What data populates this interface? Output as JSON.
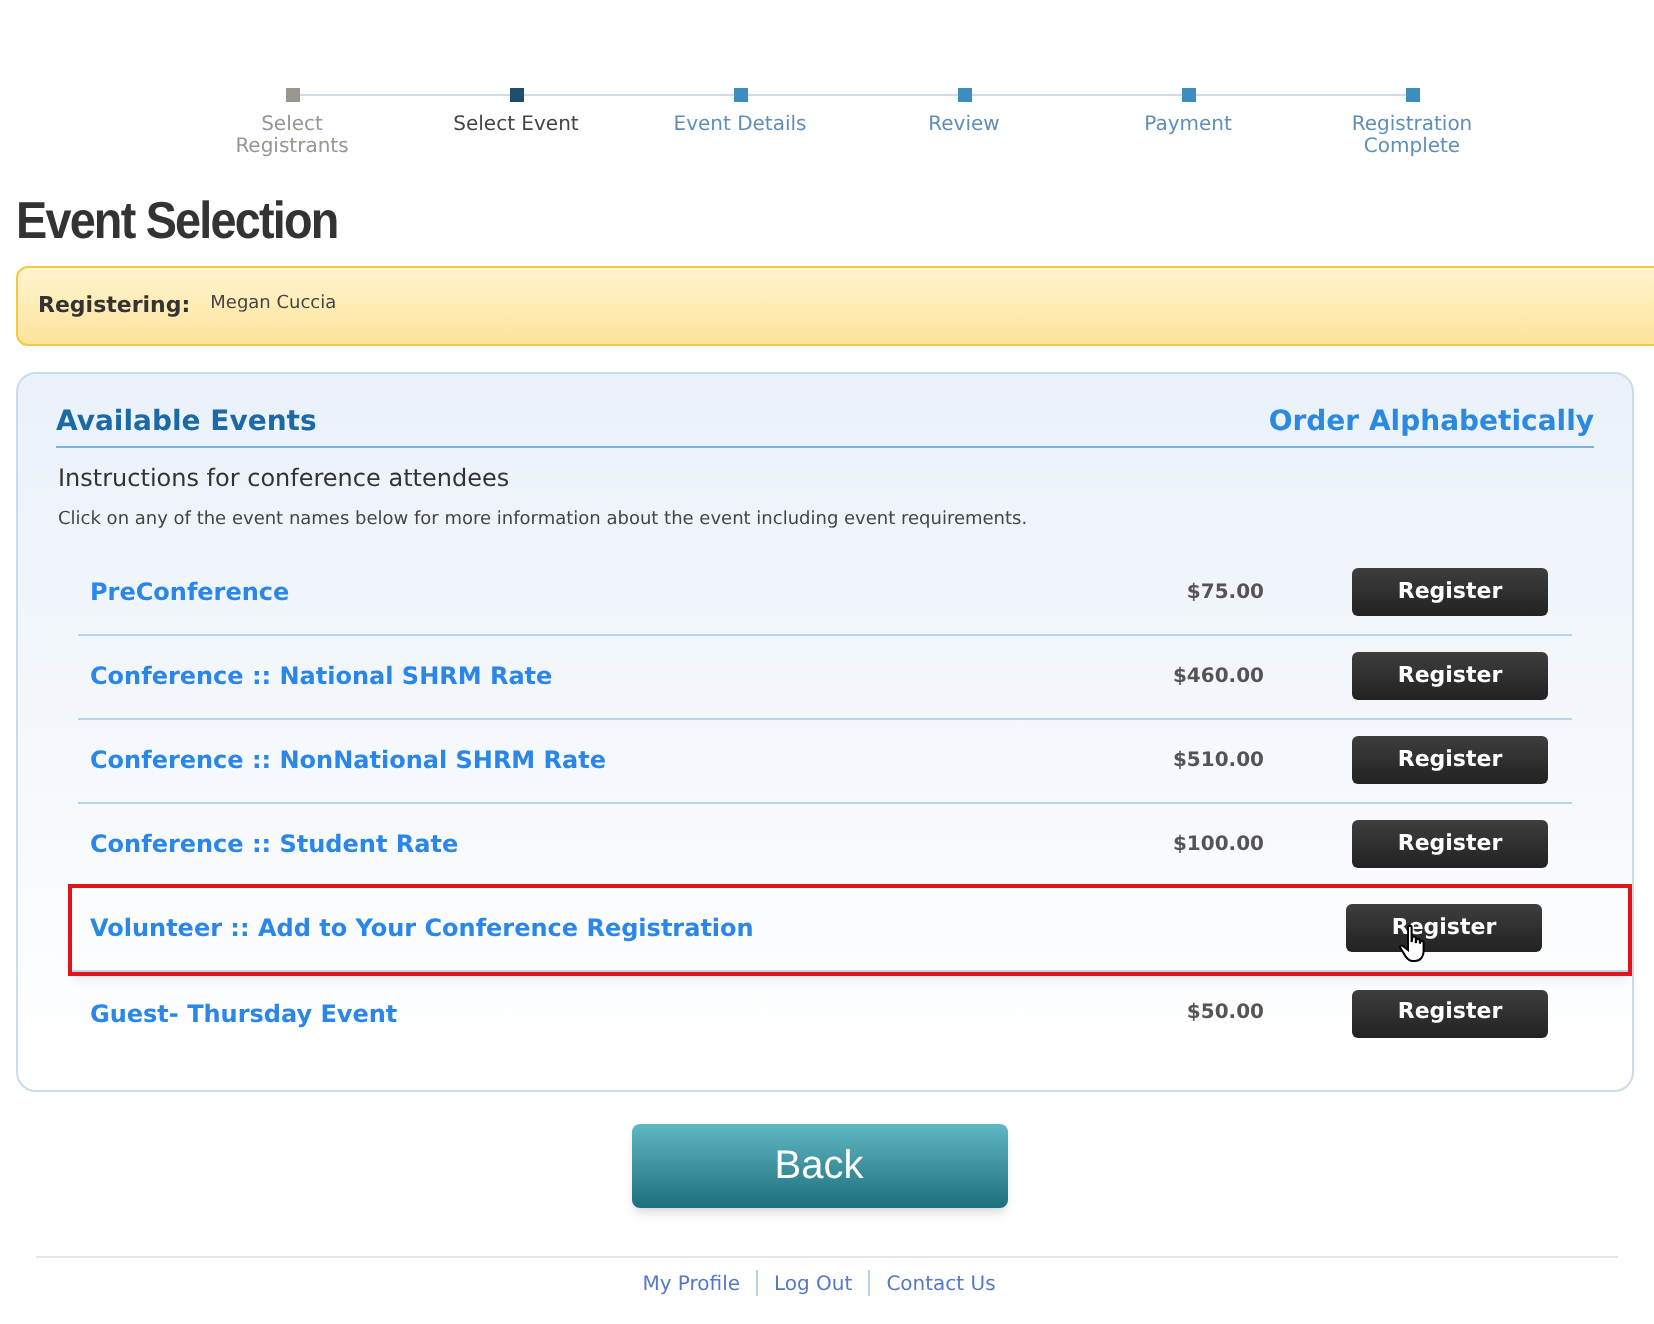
{
  "steps": [
    {
      "label": "Select Registrants",
      "completed": true,
      "selected": false
    },
    {
      "label": "Select Event",
      "completed": false,
      "selected": true
    },
    {
      "label": "Event Details",
      "completed": false,
      "selected": false
    },
    {
      "label": "Review",
      "completed": false,
      "selected": false
    },
    {
      "label": "Payment",
      "completed": false,
      "selected": false
    },
    {
      "label": "Registration Complete",
      "completed": false,
      "selected": false
    }
  ],
  "title": "Event Selection",
  "registering": {
    "label": "Registering:",
    "name": "Megan Cuccia"
  },
  "panel": {
    "title": "Available Events",
    "order_link": "Order Alphabetically",
    "instructions": "Instructions for conference attendees",
    "hint": "Click on any of the event names below for more information about the event including event requirements."
  },
  "events": [
    {
      "name": "PreConference",
      "price": "$75.00",
      "button": "Register",
      "highlighted": false
    },
    {
      "name": "Conference :: National SHRM Rate",
      "price": "$460.00",
      "button": "Register",
      "highlighted": false
    },
    {
      "name": "Conference :: NonNational SHRM Rate",
      "price": "$510.00",
      "button": "Register",
      "highlighted": false
    },
    {
      "name": "Conference :: Student Rate",
      "price": "$100.00",
      "button": "Register",
      "highlighted": false
    },
    {
      "name": "Volunteer :: Add to Your Conference Registration",
      "button": "Register",
      "highlighted": true
    },
    {
      "name": "Guest- Thursday Event",
      "price": "$50.00",
      "button": "Register",
      "highlighted": false
    }
  ],
  "back_button": "Back",
  "footer_links": [
    "My Profile",
    "Log Out",
    "Contact Us"
  ]
}
